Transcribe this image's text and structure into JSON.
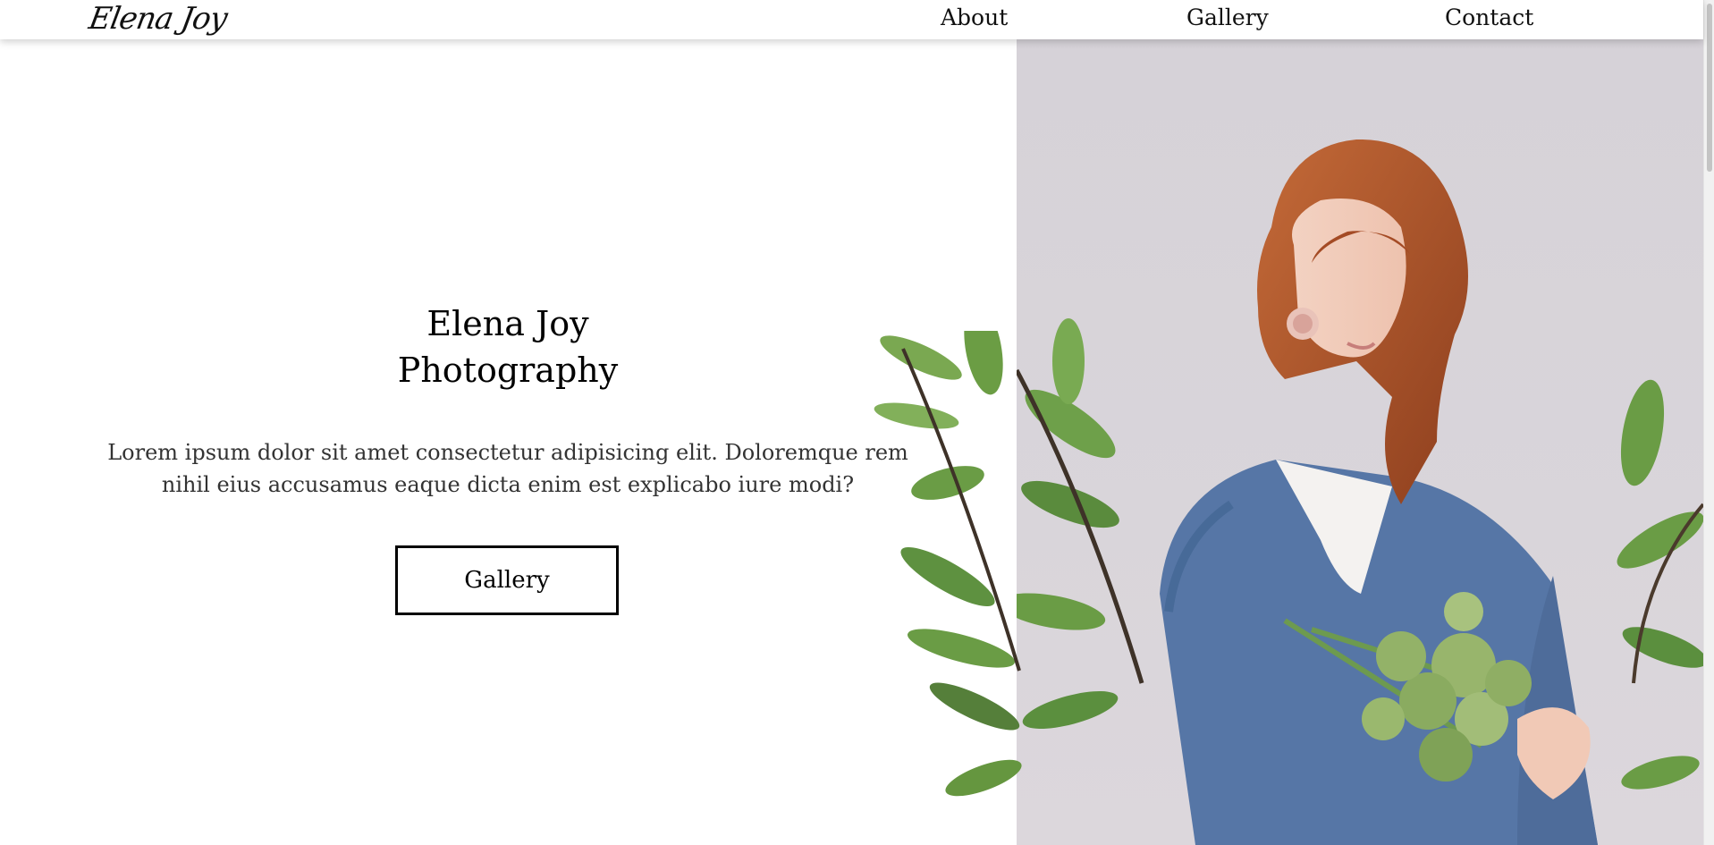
{
  "nav": {
    "logo": "Elena Joy",
    "links": [
      "About",
      "Gallery",
      "Contact"
    ]
  },
  "hero": {
    "title_line1": "Elena Joy",
    "title_line2": "Photography",
    "description": "Lorem ipsum dolor sit amet consectetur adipisicing elit. Doloremque rem nihil eius accusamus eaque dicta enim est explicabo iure modi?",
    "button_label": "Gallery"
  },
  "colors": {
    "background": "#ffffff",
    "text": "#000000",
    "body_text": "#333333",
    "photo_backdrop": "#d6d2d8",
    "hair": "#b0522a",
    "sweater": "#5676a6",
    "leaves": "#5b8f3e"
  }
}
